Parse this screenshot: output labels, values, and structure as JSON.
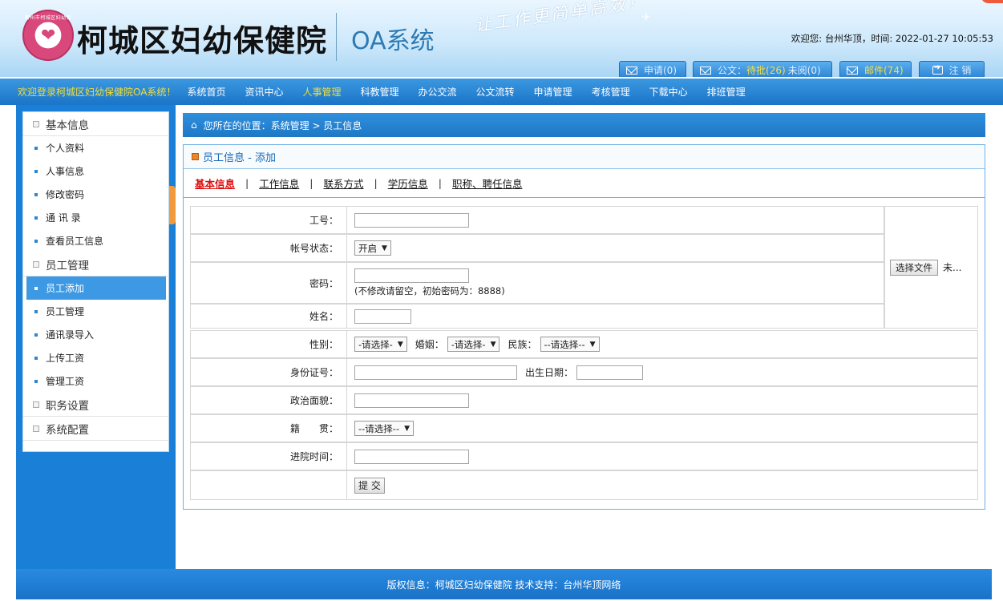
{
  "header": {
    "hospital_name": "柯城区妇幼保健院",
    "logo_ring_text": "衢州市柯城区妇幼保健院",
    "system_name": "OA系统",
    "slogan": "让工作更简单高效！",
    "welcome": "欢迎您: 台州华顶，时间: 2022-01-27 10:05:53",
    "buttons": {
      "apply": "申请(0)",
      "doc_prefix": "公文：",
      "doc_pending": "待批(26)",
      "doc_unread": "未阅(0)",
      "mail": "邮件(74)",
      "logout": "注 销"
    }
  },
  "nav": {
    "welcome": "欢迎登录柯城区妇幼保健院OA系统！",
    "items": [
      {
        "label": "系统首页"
      },
      {
        "label": "资讯中心"
      },
      {
        "label": "人事管理"
      },
      {
        "label": "科教管理"
      },
      {
        "label": "办公交流"
      },
      {
        "label": "公文流转"
      },
      {
        "label": "申请管理"
      },
      {
        "label": "考核管理"
      },
      {
        "label": "下载中心"
      },
      {
        "label": "排班管理"
      }
    ],
    "active_index": 2
  },
  "sidebar": {
    "sections": [
      {
        "title": "基本信息",
        "items": [
          "个人资料",
          "人事信息",
          "修改密码",
          "通 讯 录",
          "查看员工信息"
        ]
      },
      {
        "title": "员工管理",
        "items": [
          "员工添加",
          "员工管理",
          "通讯录导入",
          "上传工资",
          "管理工资"
        ]
      },
      {
        "title": "职务设置",
        "items": []
      },
      {
        "title": "系统配置",
        "items": []
      }
    ],
    "active_item": "员工添加"
  },
  "breadcrumb": "您所在的位置：系统管理 > 员工信息",
  "panel": {
    "title": "员工信息 - 添加",
    "tabs": [
      "基本信息",
      "工作信息",
      "联系方式",
      "学历信息",
      "职称、聘任信息"
    ]
  },
  "form": {
    "job_no": {
      "label": "工号："
    },
    "status": {
      "label": "帐号状态：",
      "value": "开启"
    },
    "password": {
      "label": "密码：",
      "hint": "(不修改请留空，初始密码为：8888)"
    },
    "name": {
      "label": "姓名："
    },
    "gender": {
      "label": "性别：",
      "value": "-请选择-"
    },
    "marriage": {
      "label": "婚姻：",
      "value": "-请选择-"
    },
    "ethnicity": {
      "label": "民族：",
      "value": "--请选择--"
    },
    "id_card": {
      "label": "身份证号："
    },
    "birthday": {
      "label": "出生日期："
    },
    "political": {
      "label": "政治面貌："
    },
    "native": {
      "label": "籍　　贯：",
      "value": "--请选择--"
    },
    "join_date": {
      "label": "进院时间："
    },
    "file_button": "选择文件",
    "file_status": "未...",
    "submit": "提 交"
  },
  "footer": "版权信息：柯城区妇幼保健院 技术支持：台州华顶网络"
}
